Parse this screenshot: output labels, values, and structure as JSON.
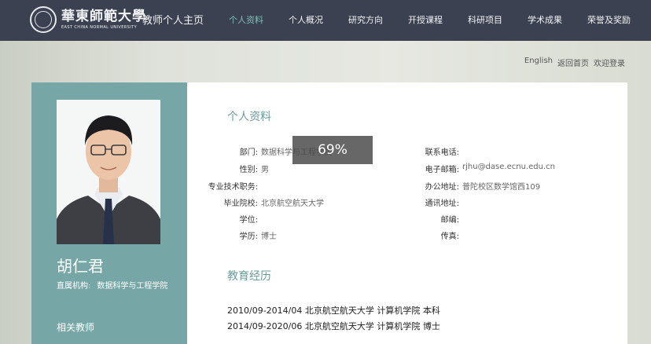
{
  "header": {
    "logo_cn": "華東師範大學",
    "logo_en": "EAST CHINA NORMAL UNIVERSITY",
    "site_title": "教师个人主页",
    "nav": [
      {
        "label": "个人资料",
        "active": true
      },
      {
        "label": "个人概况",
        "active": false
      },
      {
        "label": "研究方向",
        "active": false
      },
      {
        "label": "开授课程",
        "active": false
      },
      {
        "label": "科研项目",
        "active": false
      },
      {
        "label": "学术成果",
        "active": false
      },
      {
        "label": "荣誉及奖励",
        "active": false
      }
    ]
  },
  "toplinks": {
    "english": "English",
    "home": "返回首页",
    "login": "欢迎登录"
  },
  "profile": {
    "name": "胡仁君",
    "affil_label": "直属机构:",
    "affil_value": "数据科学与工程学院",
    "related_title": "相关教师"
  },
  "info": {
    "section_title": "个人资料",
    "left": [
      {
        "k": "部门:",
        "v": "数据科学与工程学院"
      },
      {
        "k": "性别:",
        "v": "男"
      },
      {
        "k": "专业技术职务:",
        "v": ""
      },
      {
        "k": "毕业院校:",
        "v": "北京航空航天大学"
      },
      {
        "k": "学位:",
        "v": ""
      },
      {
        "k": "学历:",
        "v": "博士"
      }
    ],
    "right": [
      {
        "k": "联系电话:",
        "v": ""
      },
      {
        "k": "电子邮箱:",
        "v": "rjhu@dase.ecnu.edu.cn"
      },
      {
        "k": "办公地址:",
        "v": "普陀校区数学馆西109"
      },
      {
        "k": "通讯地址:",
        "v": ""
      },
      {
        "k": "邮编:",
        "v": ""
      },
      {
        "k": "传真:",
        "v": ""
      }
    ]
  },
  "education": {
    "section_title": "教育经历",
    "items": [
      "2010/09-2014/04 北京航空航天大学 计算机学院 本科",
      "2014/09-2020/06 北京航空航天大学 计算机学院 博士"
    ]
  },
  "zoom": {
    "label": "69%"
  }
}
